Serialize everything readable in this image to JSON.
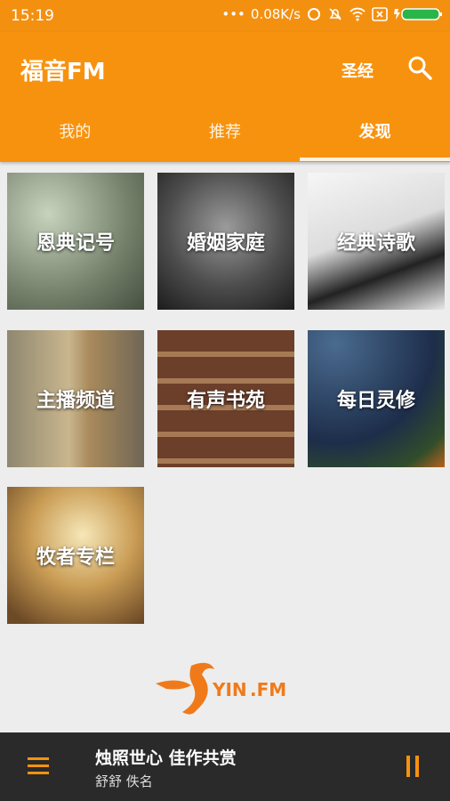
{
  "status": {
    "time": "15:19",
    "speed": "0.08K/s"
  },
  "header": {
    "title": "福音FM",
    "bible_label": "圣经"
  },
  "tabs": [
    {
      "label": "我的"
    },
    {
      "label": "推荐"
    },
    {
      "label": "发现"
    }
  ],
  "categories": [
    {
      "label": "恩典记号"
    },
    {
      "label": "婚姻家庭"
    },
    {
      "label": "经典诗歌"
    },
    {
      "label": "主播频道"
    },
    {
      "label": "有声书苑"
    },
    {
      "label": "每日灵修"
    },
    {
      "label": "牧者专栏"
    }
  ],
  "logo": {
    "text": "YIN",
    "suffix": ".FM"
  },
  "player": {
    "song": "烛照世心 佳作共赏",
    "artist": "舒舒 佚名"
  },
  "colors": {
    "accent": "#f7920f",
    "player_bg": "#2a2a2a"
  }
}
